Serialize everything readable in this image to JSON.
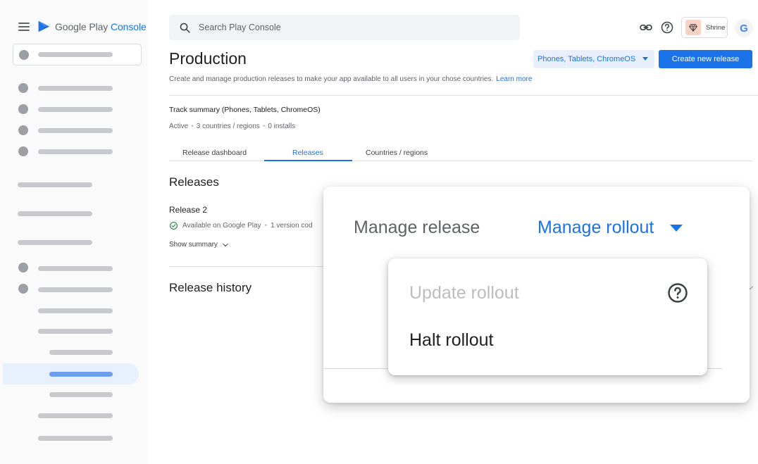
{
  "sidebar": {
    "app_name_plain": "Google Play ",
    "app_name_accent": "Console"
  },
  "header": {
    "search_placeholder": "Search Play Console",
    "account_name": "Shrine",
    "avatar_letter": "G"
  },
  "page": {
    "title": "Production",
    "device_filter": "Phones, Tablets, ChromeOS",
    "create_button": "Create new release",
    "description": "Create and manage production releases to make your app available to all users in your chose countries.",
    "learn_more": "Learn more"
  },
  "track": {
    "title": "Track summary (Phones, Tablets, ChromeOS)",
    "status": "Active",
    "countries": "3 countries / regions",
    "installs": "0 installs"
  },
  "tabs": [
    {
      "label": "Release dashboard"
    },
    {
      "label": "Releases",
      "active": true
    },
    {
      "label": "Countries / regions"
    }
  ],
  "releases": {
    "section_title": "Releases",
    "release_name": "Release 2",
    "availability": "Available on Google Play",
    "version_codes": "1 version cod",
    "show_summary": "Show summary",
    "history_title": "Release history"
  },
  "zoom": {
    "manage_release": "Manage release",
    "manage_rollout": "Manage rollout",
    "menu": {
      "update_rollout": "Update rollout",
      "halt_rollout": "Halt rollout"
    }
  },
  "colors": {
    "accent": "#1a73e8",
    "success": "#188038",
    "disabled_text": "#bdbdbd"
  },
  "icons": {
    "menu": "hamburger-icon",
    "search": "search-icon",
    "link": "link-icon",
    "help": "help-icon",
    "check": "check-circle-icon",
    "chevron": "chevron-down-icon"
  }
}
